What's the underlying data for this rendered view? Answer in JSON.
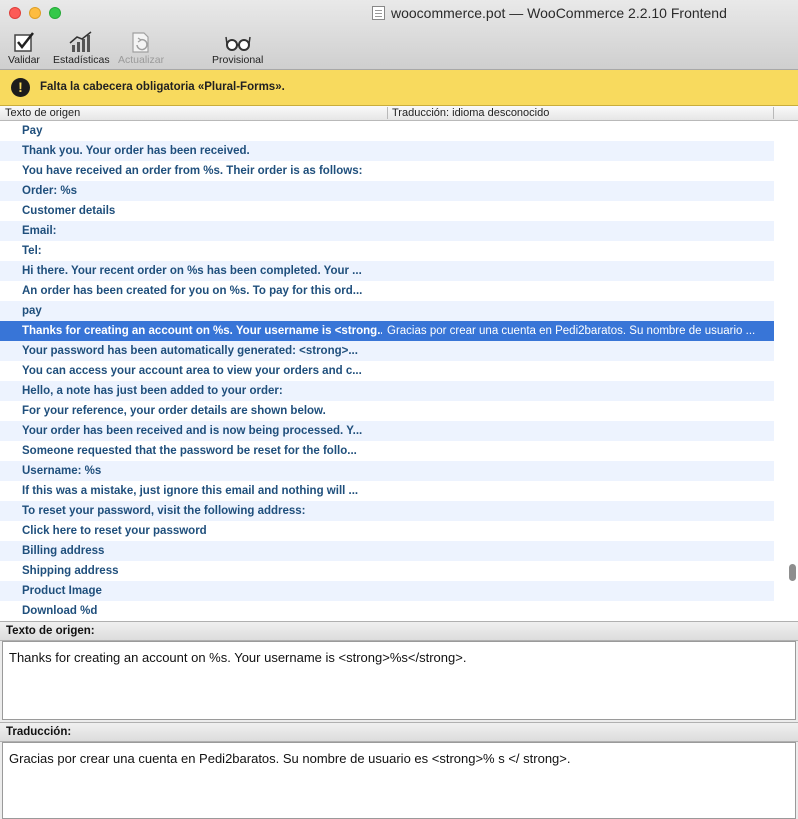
{
  "window": {
    "title": "woocommerce.pot — WooCommerce 2.2.10 Frontend"
  },
  "toolbar": {
    "validate_label": "Validar",
    "stats_label": "Estadísticas",
    "update_label": "Actualizar",
    "fuzzy_label": "Provisional"
  },
  "warning": {
    "text": "Falta la cabecera obligatoria «Plural-Forms»."
  },
  "list": {
    "col_source": "Texto de origen",
    "col_translation": "Traducción: idioma desconocido",
    "rows": [
      {
        "source": "Pay",
        "translation": ""
      },
      {
        "source": "Thank you. Your order has been received.",
        "translation": ""
      },
      {
        "source": "You have received an order from %s. Their order is as follows:",
        "translation": ""
      },
      {
        "source": "Order: %s",
        "translation": ""
      },
      {
        "source": "Customer details",
        "translation": ""
      },
      {
        "source": "Email:",
        "translation": ""
      },
      {
        "source": "Tel:",
        "translation": ""
      },
      {
        "source": "Hi there. Your recent order on %s has been completed. Your ...",
        "translation": ""
      },
      {
        "source": "An order has been created for you on %s. To pay for this ord...",
        "translation": ""
      },
      {
        "source": "pay",
        "translation": ""
      },
      {
        "source": "Thanks for creating an account on %s. Your username is <strong...",
        "translation": "Gracias por crear una cuenta en Pedi2baratos. Su nombre de usuario ..."
      },
      {
        "source": "Your password has been automatically generated: <strong>...",
        "translation": ""
      },
      {
        "source": "You can access your account area to view your orders and c...",
        "translation": ""
      },
      {
        "source": "Hello, a note has just been added to your order:",
        "translation": ""
      },
      {
        "source": "For your reference, your order details are shown below.",
        "translation": ""
      },
      {
        "source": "Your order has been received and is now being processed. Y...",
        "translation": ""
      },
      {
        "source": "Someone requested that the password be reset for the follo...",
        "translation": ""
      },
      {
        "source": "Username: %s",
        "translation": ""
      },
      {
        "source": "If this was a mistake, just ignore this email and nothing will ...",
        "translation": ""
      },
      {
        "source": "To reset your password, visit the following address:",
        "translation": ""
      },
      {
        "source": "Click here to reset your password",
        "translation": ""
      },
      {
        "source": "Billing address",
        "translation": ""
      },
      {
        "source": "Shipping address",
        "translation": ""
      },
      {
        "source": "Product Image",
        "translation": ""
      },
      {
        "source": "Download %d",
        "translation": ""
      }
    ]
  },
  "source_panel": {
    "label": "Texto de origen:",
    "text": "Thanks for creating an account on %s. Your username is <strong>%s</strong>."
  },
  "translation_panel": {
    "label": "Traducción:",
    "text": "Gracias por crear una cuenta en Pedi2baratos. Su nombre de usuario es <strong>% s </ strong>."
  }
}
